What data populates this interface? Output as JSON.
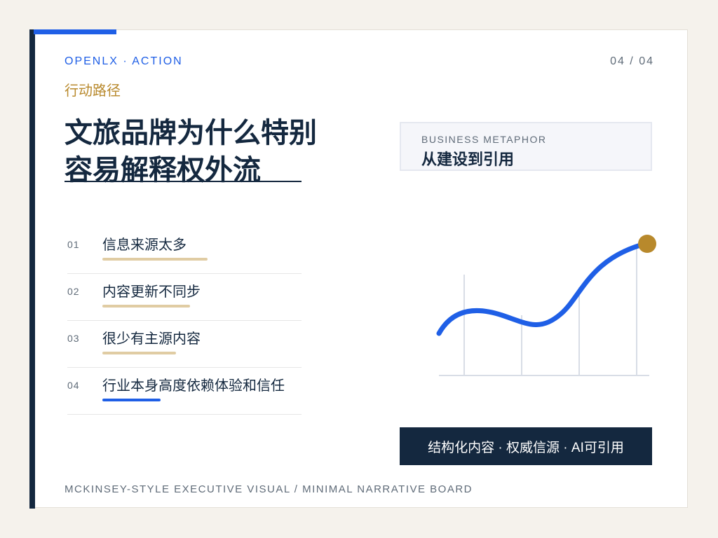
{
  "header": {
    "eyebrow": "OPENLX · ACTION",
    "page_indicator": "04 / 04",
    "subtitle": "行动路径"
  },
  "title": {
    "line1": "文旅品牌为什么特别",
    "line2": "容易解释权外流"
  },
  "metaphor": {
    "label": "BUSINESS METAPHOR",
    "title": "从建设到引用"
  },
  "list": [
    {
      "num": "01",
      "text": "信息来源太多",
      "bar_fraction": 0.6,
      "bar_color": "#e0cca3"
    },
    {
      "num": "02",
      "text": "内容更新不同步",
      "bar_fraction": 0.5,
      "bar_color": "#e0cca3"
    },
    {
      "num": "03",
      "text": "很少有主源内容",
      "bar_fraction": 0.42,
      "bar_color": "#e0cca3"
    },
    {
      "num": "04",
      "text": "行业本身高度依赖体验和信任",
      "bar_fraction": 0.33,
      "bar_color": "#1f5fe6"
    }
  ],
  "tagline": "结构化内容 · 权威信源 · AI可引用",
  "footer": "MCKINSEY-STYLE EXECUTIVE VISUAL / MINIMAL NARRATIVE BOARD",
  "colors": {
    "navy": "#14283f",
    "blue": "#1f5fe6",
    "gold": "#b8892c",
    "sand": "#e0cca3"
  }
}
